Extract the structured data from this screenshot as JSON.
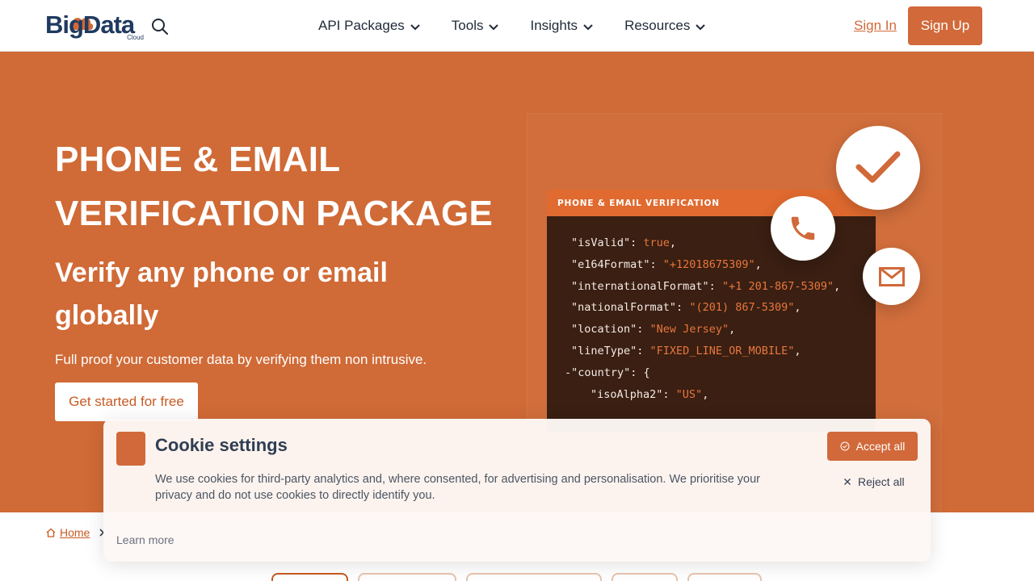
{
  "brand": {
    "logo_text": "BigData",
    "logo_sub": "Cloud",
    "accent_color": "#d1693a"
  },
  "nav": {
    "items": [
      {
        "label": "API Packages"
      },
      {
        "label": "Tools"
      },
      {
        "label": "Insights"
      },
      {
        "label": "Resources"
      }
    ],
    "sign_in": "Sign In",
    "sign_up": "Sign Up"
  },
  "hero": {
    "title": "PHONE & EMAIL VERIFICATION PACKAGE",
    "subtitle": "Verify any phone or email globally",
    "description": "Full proof your customer data by verifying them non intrusive.",
    "cta": "Get started for free",
    "background_color": "#d06a36"
  },
  "code_card": {
    "header": "PHONE & EMAIL VERIFICATION",
    "lines": [
      {
        "key": "\"isValid\": ",
        "value": "true",
        "suffix": ","
      },
      {
        "key": "\"e164Format\": ",
        "value": "\"+12018675309\"",
        "suffix": ","
      },
      {
        "key": "\"internationalFormat\": ",
        "value": "\"+1 201-867-5309\"",
        "suffix": ","
      },
      {
        "key": "\"nationalFormat\": ",
        "value": "\"(201) 867-5309\"",
        "suffix": ","
      },
      {
        "key": "\"location\": ",
        "value": "\"New Jersey\"",
        "suffix": ","
      },
      {
        "key": "\"lineType\": ",
        "value": "\"FIXED_LINE_OR_MOBILE\"",
        "suffix": ","
      },
      {
        "key": "-\"country\": {",
        "value": "",
        "suffix": ""
      },
      {
        "key": "\"isoAlpha2\": ",
        "value": "\"US\"",
        "suffix": ","
      }
    ]
  },
  "breadcrumb": {
    "home": "Home"
  },
  "cookie": {
    "title": "Cookie settings",
    "text": "We use cookies for third-party analytics and, where consented, for advertising and personalisation. We prioritise your privacy and do not use cookies to directly identify you.",
    "accept": "Accept all",
    "reject": "Reject all",
    "learn_more": "Learn more"
  }
}
